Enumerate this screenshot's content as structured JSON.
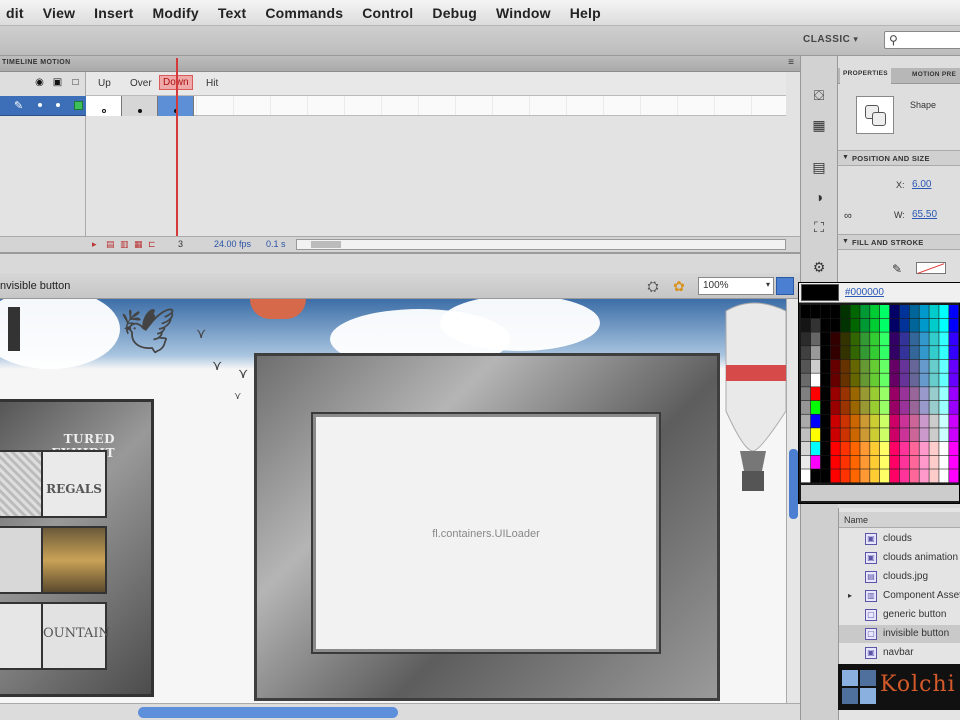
{
  "menu": [
    "dit",
    "View",
    "Insert",
    "Modify",
    "Text",
    "Commands",
    "Control",
    "Debug",
    "Window",
    "Help"
  ],
  "appbar": {
    "workspace": "CLASSIC",
    "workspace_arrow": "▾",
    "search_glyph": "⚲"
  },
  "timeline": {
    "tab_title": "TIMELINE  MOTION",
    "panel_menu": "≡",
    "frame_labels": [
      "Up",
      "Over",
      "Down",
      "Hit"
    ],
    "status": {
      "frame": "3",
      "fps": "24.00 fps",
      "time": "0.1 s"
    }
  },
  "editbar": {
    "crumb": "nvisible button",
    "zoom": "100%"
  },
  "stage": {
    "featured": "TURED EXHIBIT",
    "regals": "REGALS",
    "fountain": "OUNTAIN",
    "loader_label": "fl.containers.UILoader"
  },
  "properties": {
    "tabs": [
      "PROPERTIES",
      "MOTION PRE"
    ],
    "type": "Shape",
    "section_position": "POSITION AND SIZE",
    "x_label": "X:",
    "x_value": "6.00",
    "w_label": "W:",
    "w_value": "65.50",
    "section_fill": "FILL AND STROKE"
  },
  "swatches": {
    "hex": "#000000"
  },
  "library": {
    "header": "Name",
    "items": [
      {
        "label": "clouds",
        "icon": "▣",
        "selected": false
      },
      {
        "label": "clouds animation",
        "icon": "▣",
        "selected": false
      },
      {
        "label": "clouds.jpg",
        "icon": "▤",
        "selected": false
      },
      {
        "label": "Component Assets",
        "icon": "▥",
        "selected": false
      },
      {
        "label": "generic button",
        "icon": "▢",
        "selected": false
      },
      {
        "label": "invisible button",
        "icon": "▢",
        "selected": true
      },
      {
        "label": "navbar",
        "icon": "▣",
        "selected": false
      }
    ],
    "logo": "Kolchi"
  }
}
